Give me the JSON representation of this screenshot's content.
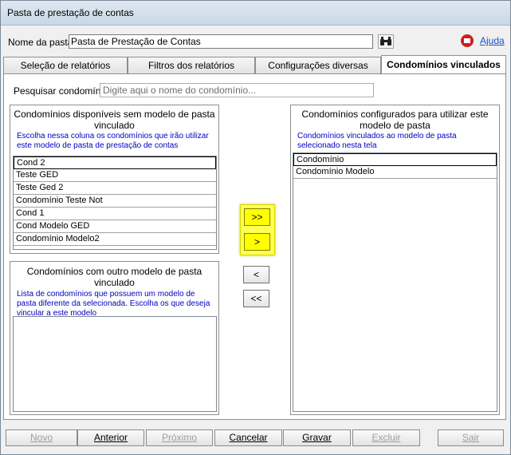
{
  "window": {
    "title": "Pasta de prestação de contas"
  },
  "header": {
    "name_label": "Nome da pasta:",
    "name_value": "Pasta de Prestação de Contas",
    "help_label": "Ajuda"
  },
  "tabs": [
    {
      "label": "Seleção de relatórios"
    },
    {
      "label": "Filtros dos relatórios"
    },
    {
      "label": "Configurações diversas"
    },
    {
      "label": "Condomínios vinculados"
    }
  ],
  "search": {
    "label": "Pesquisar condomínio:",
    "placeholder": "Digite aqui o nome do condomínio..."
  },
  "available": {
    "title": "Condomínios disponíveis sem modelo de pasta vinculado",
    "desc": "Escolha nessa coluna os condomínios que irão utilizar este modelo de pasta de prestação de contas",
    "items": [
      "Cond 2",
      "Teste GED",
      "Teste Ged 2",
      "Condomínio Teste Not",
      "Cond 1",
      "Cond Modelo GED",
      "Condomínio Modelo2"
    ]
  },
  "other": {
    "title": "Condomínios com outro modelo de pasta vinculado",
    "desc": "Lista de condomínios que possuem um modelo de pasta diferente da selecionada. Escolha os que deseja vincular a este modelo"
  },
  "configured": {
    "title": "Condomínios configurados para utilizar este modelo de pasta",
    "desc": "Condomínios vinculados ao modelo de pasta selecionado nesta tela",
    "items": [
      "Condomínio",
      "Condomínio Modelo"
    ]
  },
  "move_buttons": {
    "all_right": ">>",
    "right": ">",
    "left": "<",
    "all_left": "<<"
  },
  "bottom": {
    "novo": "Novo",
    "anterior": "Anterior",
    "proximo": "Próximo",
    "cancelar": "Cancelar",
    "gravar": "Gravar",
    "excluir": "Excluir",
    "sair": "Sair"
  }
}
